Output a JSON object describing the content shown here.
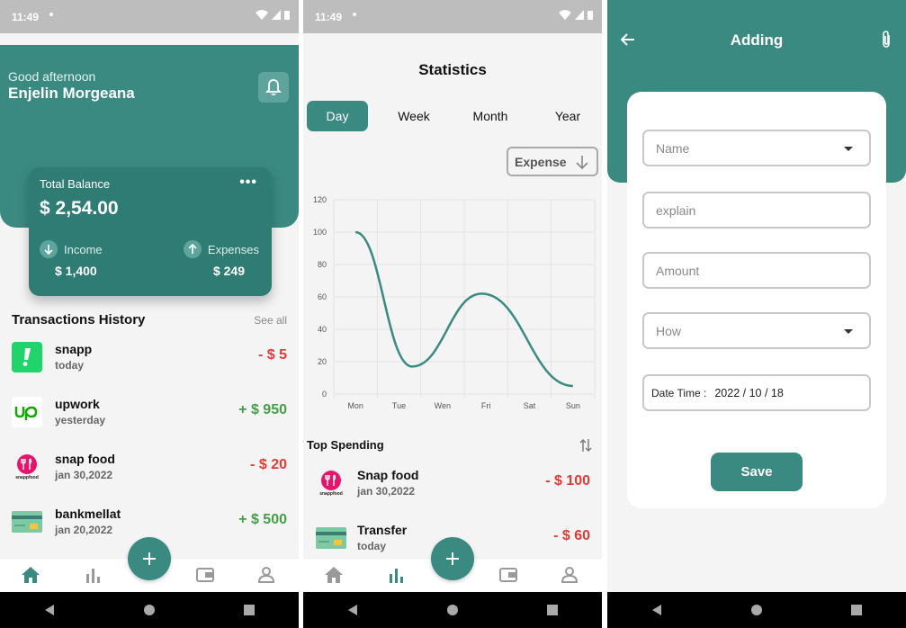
{
  "status": {
    "time": "11:49"
  },
  "home": {
    "greeting": "Good afternoon",
    "user_name": "Enjelin Morgeana",
    "card": {
      "label": "Total Balance",
      "balance": "$ 2,54.00",
      "income_label": "Income",
      "income_value": "$ 1,400",
      "expenses_label": "Expenses",
      "expenses_value": "$ 249"
    },
    "history_title": "Transactions History",
    "see_all": "See all",
    "transactions": [
      {
        "name": "snapp",
        "date": "today",
        "amount": "- $ 5",
        "type": "neg",
        "icon": "snapp-icon"
      },
      {
        "name": "upwork",
        "date": "yesterday",
        "amount": "+ $ 950",
        "type": "pos",
        "icon": "upwork-icon"
      },
      {
        "name": "snap food",
        "date": "jan 30,2022",
        "amount": "- $ 20",
        "type": "neg",
        "icon": "snapfood-icon"
      },
      {
        "name": "bankmellat",
        "date": "jan 20,2022",
        "amount": "+ $ 500",
        "type": "pos",
        "icon": "card-icon"
      }
    ]
  },
  "stats": {
    "title": "Statistics",
    "tabs": [
      "Day",
      "Week",
      "Month",
      "Year"
    ],
    "active_tab": "Day",
    "filter": "Expense",
    "top_spending_title": "Top Spending",
    "top_spending": [
      {
        "name": "Snap food",
        "date": "jan 30,2022",
        "amount": "- $ 100",
        "icon": "snapfood-icon"
      },
      {
        "name": "Transfer",
        "date": "today",
        "amount": "- $ 60",
        "icon": "card-icon"
      }
    ]
  },
  "adding": {
    "title": "Adding",
    "name_placeholder": "Name",
    "explain_placeholder": "explain",
    "amount_placeholder": "Amount",
    "how_placeholder": "How",
    "date_label": "Date Time :",
    "date_value": "2022 / 10 / 18",
    "save_label": "Save"
  },
  "colors": {
    "primary": "#3a8a82",
    "negative": "#e53935",
    "positive": "#43a047"
  },
  "chart_data": {
    "type": "line",
    "x": [
      "Mon",
      "Tue",
      "Wen",
      "Fri",
      "Sat",
      "Sun"
    ],
    "yticks": [
      0,
      20,
      40,
      60,
      80,
      100,
      120
    ],
    "ylim": [
      0,
      120
    ],
    "series": [
      {
        "values": [
          100,
          17,
          62,
          5
        ]
      }
    ],
    "series_x_index": [
      0,
      1.3,
      2.9,
      5
    ],
    "grid": true
  }
}
